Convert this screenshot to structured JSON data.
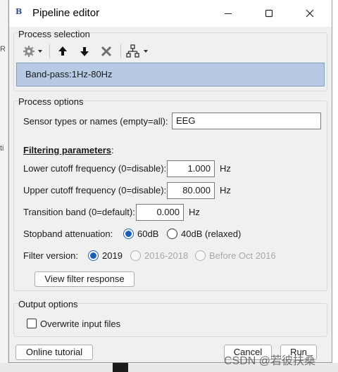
{
  "background": {
    "left_fragments": [
      "R",
      "ti"
    ]
  },
  "window": {
    "title": "Pipeline editor",
    "app_icon_text": "B"
  },
  "process_selection": {
    "title": "Process selection",
    "toolbar": [
      "gear-menu",
      "move-up",
      "move-down",
      "delete",
      "pipeline-menu"
    ],
    "items": [
      "Band-pass:1Hz-80Hz"
    ]
  },
  "process_options": {
    "title": "Process options",
    "sensor_label": "Sensor types or names (empty=all):",
    "sensor_value": "EEG",
    "filtering_heading": "Filtering parameters",
    "filtering_colon": ":",
    "lower_label": "Lower cutoff frequency (0=disable):",
    "lower_value": "1.000",
    "lower_unit": "Hz",
    "upper_label": "Upper cutoff frequency (0=disable):",
    "upper_value": "80.000",
    "upper_unit": "Hz",
    "transition_label": "Transition band (0=default):",
    "transition_value": "0.000",
    "transition_unit": "Hz",
    "stopband_label": "Stopband attenuation:",
    "stopband_options": [
      "60dB",
      "40dB (relaxed)"
    ],
    "stopband_selected": "60dB",
    "version_label": "Filter version:",
    "version_options": [
      "2019",
      "2016-2018",
      "Before Oct 2016"
    ],
    "version_selected": "2019",
    "view_response_button": "View filter response"
  },
  "output_options": {
    "title": "Output options",
    "overwrite_label": "Overwrite input files",
    "overwrite_checked": false
  },
  "footer": {
    "tutorial_button": "Online tutorial",
    "cancel_button": "Cancel",
    "run_button": "Run"
  },
  "watermark": "CSDN @若彼扶桑",
  "colors": {
    "selection": "#b6cbe3",
    "radio_accent": "#1a5fb4",
    "delete_icon": "#6e6e6e"
  }
}
